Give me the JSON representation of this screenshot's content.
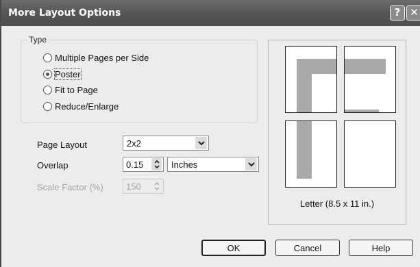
{
  "window": {
    "title": "More Layout Options",
    "help_glyph": "?",
    "close_glyph": "✕"
  },
  "type_group": {
    "label": "Type",
    "options": [
      {
        "label": "Multiple Pages per Side",
        "checked": false
      },
      {
        "label": "Poster",
        "checked": true
      },
      {
        "label": "Fit to Page",
        "checked": false
      },
      {
        "label": "Reduce/Enlarge",
        "checked": false
      }
    ]
  },
  "page_layout": {
    "label": "Page Layout",
    "value": "2x2"
  },
  "overlap": {
    "label": "Overlap",
    "value": "0.15",
    "unit": "Inches"
  },
  "scale_factor": {
    "label": "Scale Factor (%)",
    "value": "150",
    "enabled": false
  },
  "preview": {
    "caption": "Letter (8.5 x 11 in.)",
    "grid": "2x2",
    "shade_color": "#a9a9a9"
  },
  "buttons": {
    "ok": "OK",
    "cancel": "Cancel",
    "help": "Help"
  },
  "icons": {
    "dropdown": "chevron-down-icon",
    "spinner": "spinner-arrows-icon",
    "radio": "radio-icon"
  }
}
